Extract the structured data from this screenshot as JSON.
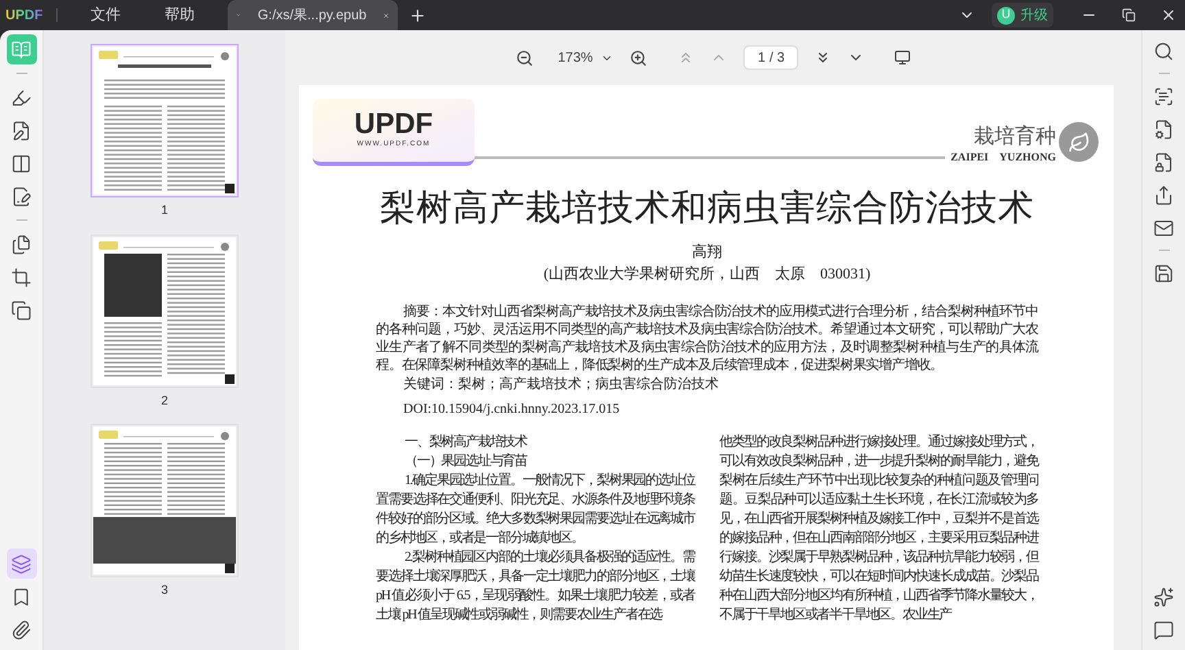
{
  "title_bar": {
    "logo": "UPDF",
    "menu": [
      "文件",
      "帮助"
    ],
    "tabs": [
      {
        "label": "G:/xs/果...py.epub",
        "selected": true
      }
    ],
    "avatar": "U",
    "upgrade": "升级"
  },
  "left_rail": {
    "top": [
      {
        "kind": "reader",
        "selected": true
      },
      {
        "kind": "comment",
        "selected": false
      },
      {
        "kind": "edit",
        "selected": false
      },
      {
        "kind": "form",
        "selected": false
      },
      {
        "kind": "sign",
        "selected": false
      }
    ],
    "middle": [
      {
        "kind": "organize",
        "selected": false
      },
      {
        "kind": "crop",
        "selected": false
      },
      {
        "kind": "copy",
        "selected": false
      }
    ],
    "bottom": [
      {
        "kind": "layers",
        "selected": true
      },
      {
        "kind": "bookmark",
        "selected": false
      },
      {
        "kind": "attachment",
        "selected": false
      }
    ]
  },
  "thumbnails": [
    {
      "page": "1",
      "kind": "text",
      "selected": true
    },
    {
      "page": "2",
      "kind": "photo_top",
      "selected": false
    },
    {
      "page": "3",
      "kind": "photo_bottom",
      "selected": false
    }
  ],
  "toolbar": {
    "zoom": "173%",
    "page": "1",
    "total": "/ 3"
  },
  "document": {
    "logo": "UPDF",
    "logo_url": "WWW.UPDF.COM",
    "section": "栽培育种",
    "section_en": [
      "ZAIPEI",
      "YUZHONG"
    ],
    "title": "梨树高产栽培技术和病虫害综合防治技术",
    "author": "高翔",
    "affiliation": "(山西农业大学果树研究所，山西　太原　030031)",
    "abstract": "摘要：本文针对山西省梨树高产栽培技术及病虫害综合防治技术的应用模式进行合理分析，结合梨树种植环节中的各种问题，巧妙、灵活运用不同类型的高产栽培技术及病虫害综合防治技术。希望通过本文研究，可以帮助广大农业生产者了解不同类型的梨树高产栽培技术及病虫害综合防治技术的应用方法，及时调整梨树种植与生产的具体流程。在保障梨树种植效率的基础上，降低梨树的生产成本及后续管理成本，促进梨树果实增产增收。",
    "keywords": "关键词：梨树；高产栽培技术；病虫害综合防治技术",
    "doi": "DOI:10.15904/j.cnki.hnny.2023.17.015",
    "left_column": [
      {
        "kind": "heading",
        "text": "一、梨树高产栽培技术"
      },
      {
        "kind": "heading",
        "text": "（一）果园选址与育苗"
      },
      {
        "kind": "paragraph",
        "text": "1.确定果园选址位置。一般情况下，梨树果园的选址位置需要选择在交通便利、阳光充足、水源条件及地理环境条件较好的部分区域。绝大多数梨树果园需要选址在远离城市的乡村地区，或者是一部分城镇地区。"
      },
      {
        "kind": "paragraph",
        "text": "2.梨树种植园区内部的土壤必须具备极强的适应性。需要选择土壤深厚肥沃，具备一定土壤肥力的部分地区，土壤 pH 值必须小于 6.5，呈现弱酸性。如果土壤肥力较差，或者土壤 pH 值呈现碱性或弱碱性，则需要农业生产者在选"
      }
    ],
    "right_column": [
      {
        "kind": "continuation",
        "text": "他类型的改良梨树品种进行嫁接处理。通过嫁接处理方式，可以有效改良梨树品种，进一步提升梨树的耐旱能力，避免梨树在后续生产环节中出现比较复杂的种植问题及管理问题。豆梨品种可以适应黏土生长环境，在长江流域较为多见，在山西省开展梨树种植及嫁接工作中，豆梨并不是首选的嫁接品种，但在山西南部部分地区，主要采用豆梨品种进行嫁接。沙梨属于早熟梨树品种，该品种抗旱能力较弱，但幼苗生长速度较快，可以在短时间内快速长成成苗。沙梨品种在山西大部分地区均有所种植，山西省季节降水量较大，不属于干旱地区或者半干旱地区。农业生产"
      }
    ]
  },
  "right_rail": {
    "top": [
      {
        "kind": "search"
      },
      {
        "kind": "ocr"
      },
      {
        "kind": "convert"
      },
      {
        "kind": "protect"
      },
      {
        "kind": "share"
      },
      {
        "kind": "mail"
      },
      {
        "kind": "save"
      }
    ],
    "bottom": [
      {
        "kind": "ai"
      },
      {
        "kind": "comment"
      }
    ]
  }
}
